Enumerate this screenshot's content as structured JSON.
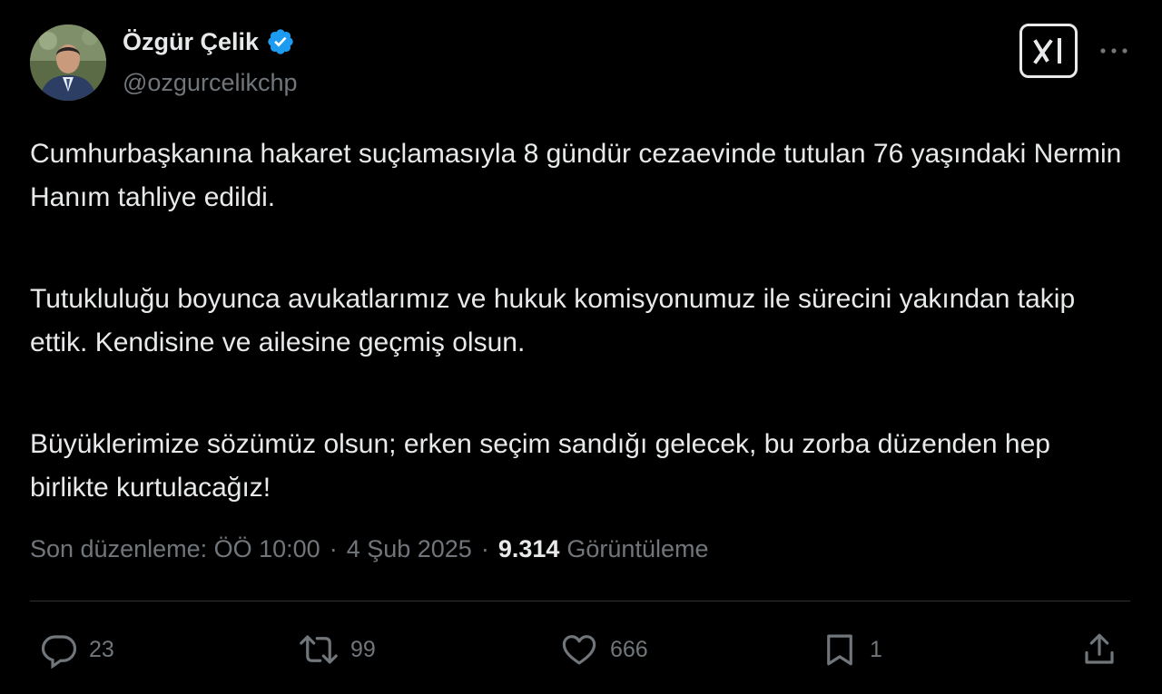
{
  "author": {
    "display_name": "Özgür Çelik",
    "handle": "@ozgurcelikchp",
    "verified": true,
    "avatar_icon": "profile-photo"
  },
  "header": {
    "grok_icon": "grok-logo-icon",
    "more_icon": "more-horizontal-icon"
  },
  "tweet": {
    "paragraphs": [
      "Cumhurbaşkanına hakaret suçlamasıyla 8 gündür cezaevinde tutulan 76 yaşındaki Nermin Hanım tahliye edildi.",
      "Tutukluluğu boyunca avukatlarımız ve hukuk komisyonumuz ile sürecini yakından takip ettik. Kendisine ve ailesine geçmiş olsun.",
      "Büyüklerimize sözümüz olsun; erken seçim sandığı gelecek, bu zorba düzenden hep birlikte kurtulacağız!"
    ]
  },
  "meta": {
    "edited_label": "Son düzenleme: ÖÖ 10:00",
    "separator": "·",
    "date": "4 Şub 2025",
    "views_count": "9.314",
    "views_label": "Görüntüleme"
  },
  "actions": {
    "replies": "23",
    "reposts": "99",
    "likes": "666",
    "bookmarks": "1"
  },
  "colors": {
    "background": "#000000",
    "text_primary": "#e7e9ea",
    "text_secondary": "#71767b",
    "verified_blue": "#1d9bf0",
    "divider": "#2f3336"
  }
}
